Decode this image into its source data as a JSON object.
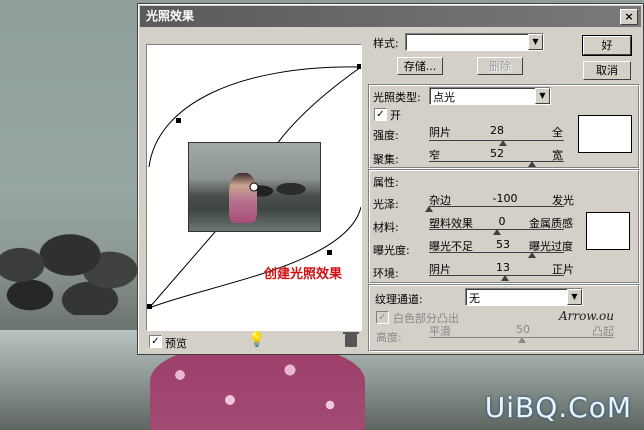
{
  "watermark": "UiBQ.CoM",
  "dialog": {
    "title": "光照效果",
    "close": "×",
    "ok_label": "好",
    "cancel_label": "取消",
    "style_label": "样式:",
    "style_value": "",
    "save_label": "存储...",
    "delete_label": "删除",
    "light_type_section": "光照类型:",
    "light_type_value": "点光",
    "on_label": "开",
    "on_checked": "✓",
    "intensity": {
      "label": "强度:",
      "min_label": "阴片",
      "value": "28",
      "max_label": "全",
      "level_pct": 55
    },
    "focus": {
      "label": "聚集:",
      "min_label": "窄",
      "value": "52",
      "max_label": "宽",
      "level_pct": 76
    },
    "properties_section": "属性:",
    "gloss": {
      "label": "光泽:",
      "min_label": "杂边",
      "value": "-100",
      "max_label": "发光",
      "level_pct": 0
    },
    "material": {
      "label": "材料:",
      "min_label": "塑料效果",
      "value": "0",
      "max_label": "金属质感",
      "level_pct": 50
    },
    "exposure": {
      "label": "曝光度:",
      "min_label": "曝光不足",
      "value": "53",
      "max_label": "曝光过度",
      "level_pct": 76
    },
    "ambience": {
      "label": "环境:",
      "min_label": "阴片",
      "value": "13",
      "max_label": "正片",
      "level_pct": 56
    },
    "texture_label": "纹理通道:",
    "texture_value": "无",
    "white_high_label": "白色部分凸出",
    "white_high_checked": "✓",
    "height": {
      "label": "高度:",
      "min_label": "平滑",
      "value": "50",
      "max_label": "凸起",
      "level_pct": 50
    },
    "preview_label": "预览",
    "preview_checked": "✓",
    "bulb_icon": "💡",
    "annotation": "创建光照效果",
    "signature": "Arrow.ou"
  }
}
